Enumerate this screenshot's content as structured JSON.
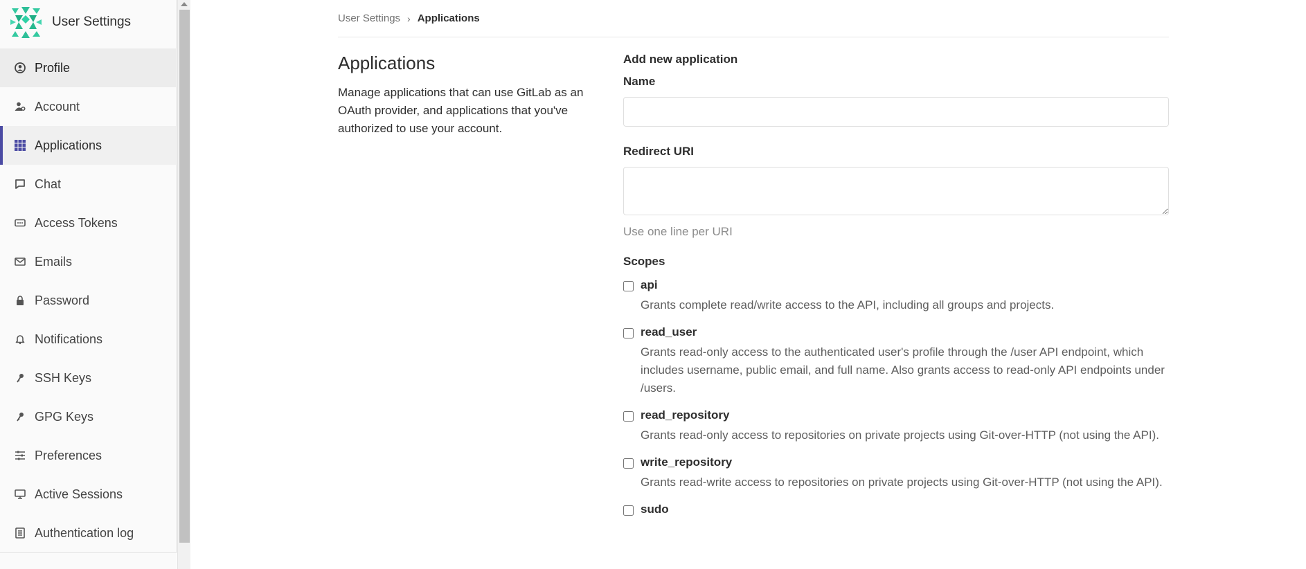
{
  "sidebar": {
    "title": "User Settings",
    "items": [
      {
        "label": "Profile",
        "icon": "profile-icon"
      },
      {
        "label": "Account",
        "icon": "account-icon"
      },
      {
        "label": "Applications",
        "icon": "applications-icon"
      },
      {
        "label": "Chat",
        "icon": "chat-icon"
      },
      {
        "label": "Access Tokens",
        "icon": "access-tokens-icon"
      },
      {
        "label": "Emails",
        "icon": "email-icon"
      },
      {
        "label": "Password",
        "icon": "lock-icon"
      },
      {
        "label": "Notifications",
        "icon": "bell-icon"
      },
      {
        "label": "SSH Keys",
        "icon": "key-icon"
      },
      {
        "label": "GPG Keys",
        "icon": "key-icon"
      },
      {
        "label": "Preferences",
        "icon": "preferences-icon"
      },
      {
        "label": "Active Sessions",
        "icon": "monitor-icon"
      },
      {
        "label": "Authentication log",
        "icon": "log-icon"
      }
    ],
    "active": "Applications",
    "hovered": "Profile",
    "accent_color": "#4b4ba3"
  },
  "breadcrumb": {
    "parent": "User Settings",
    "current": "Applications"
  },
  "intro": {
    "title": "Applications",
    "description": "Manage applications that can use GitLab as an OAuth provider, and applications that you've authorized to use your account."
  },
  "form": {
    "heading": "Add new application",
    "name_label": "Name",
    "name_value": "",
    "redirect_label": "Redirect URI",
    "redirect_value": "",
    "redirect_help": "Use one line per URI",
    "scopes_label": "Scopes",
    "scopes": [
      {
        "name": "api",
        "description": "Grants complete read/write access to the API, including all groups and projects.",
        "checked": false
      },
      {
        "name": "read_user",
        "description": "Grants read-only access to the authenticated user's profile through the /user API endpoint, which includes username, public email, and full name. Also grants access to read-only API endpoints under /users.",
        "checked": false
      },
      {
        "name": "read_repository",
        "description": "Grants read-only access to repositories on private projects using Git-over-HTTP (not using the API).",
        "checked": false
      },
      {
        "name": "write_repository",
        "description": "Grants read-write access to repositories on private projects using Git-over-HTTP (not using the API).",
        "checked": false
      },
      {
        "name": "sudo",
        "description": "",
        "checked": false
      }
    ]
  }
}
